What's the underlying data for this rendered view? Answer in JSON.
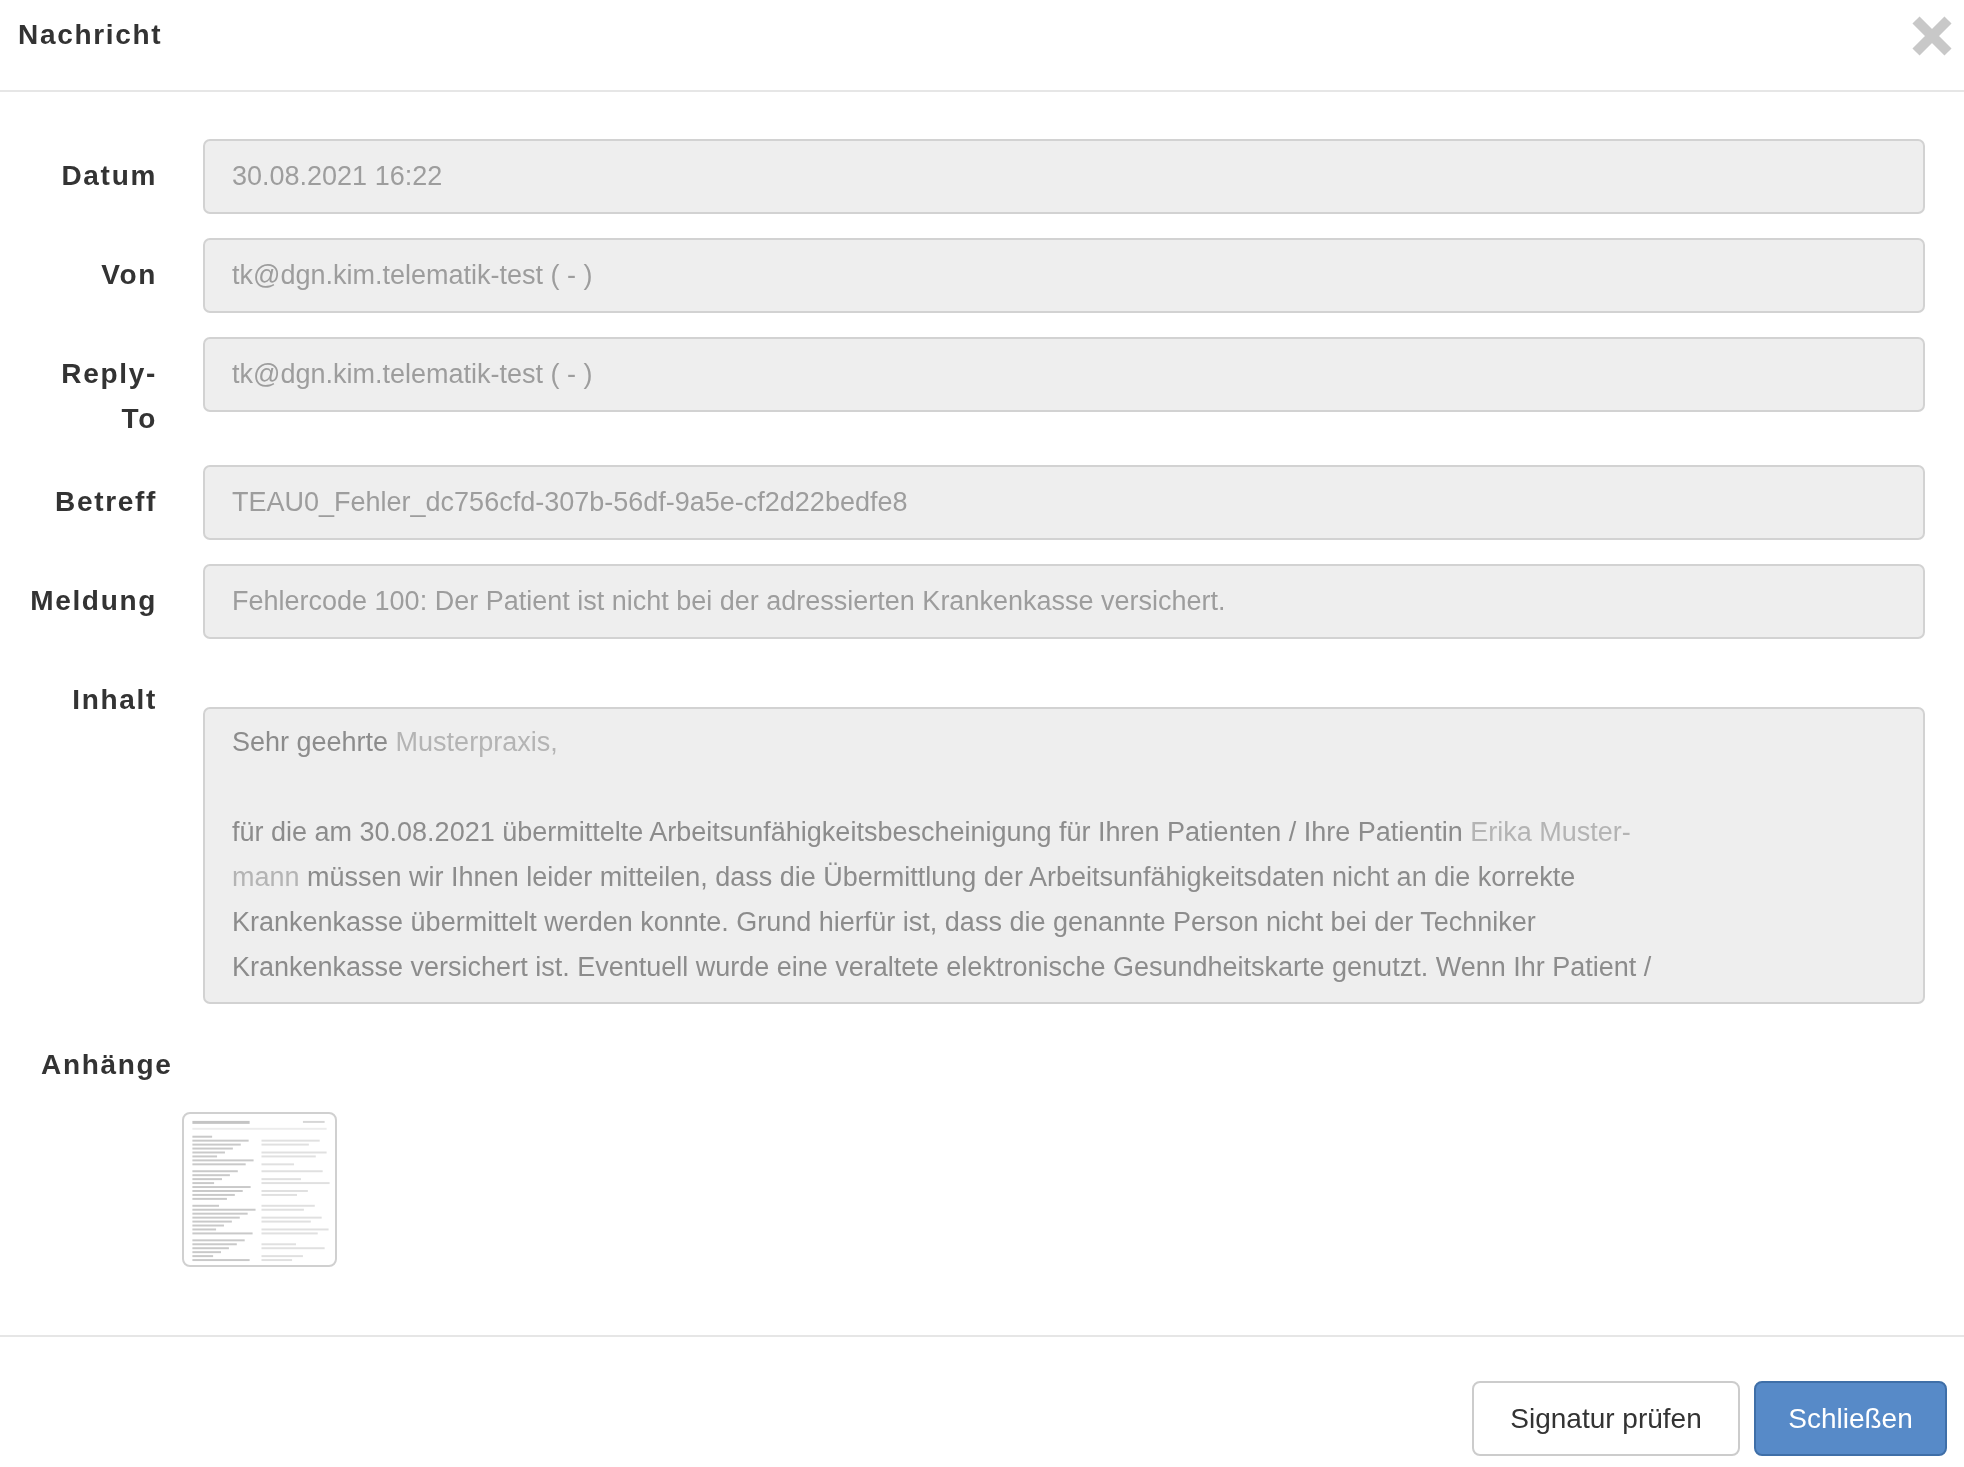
{
  "dialog": {
    "title": "Nachricht"
  },
  "fields": [
    {
      "label": "Datum",
      "value": "30.08.2021 16:22"
    },
    {
      "label": "Von",
      "value": "tk@dgn.kim.telematik-test ( - )"
    },
    {
      "label": "Reply-To",
      "value": "tk@dgn.kim.telematik-test ( - )"
    },
    {
      "label": "Betreff",
      "value": "TEAU0_Fehler_dc756cfd-307b-56df-9a5e-cf2d22bedfe8"
    },
    {
      "label": "Meldung",
      "value": "Fehlercode 100: Der Patient ist nicht bei der adressierten Krankenkasse versichert."
    }
  ],
  "content": {
    "label": "Inhalt",
    "paragraphs": [
      {
        "lines": [
          [
            {
              "kind": "text",
              "text": "Sehr geehrte "
            },
            {
              "kind": "variable",
              "text": "Musterpraxis,"
            }
          ]
        ]
      },
      {
        "lines": [
          [
            {
              "kind": "text",
              "text": "für die am 30.08.2021 übermittelte Arbeitsunfähigkeitsbescheinigung für Ihren Patienten / Ihre Patientin "
            },
            {
              "kind": "variable",
              "text": "Erika Muster-"
            }
          ],
          [
            {
              "kind": "variable",
              "text": "mann "
            },
            {
              "kind": "text",
              "text": "müssen wir Ihnen leider mitteilen, dass die Übermittlung der Arbeitsunfähigkeitsdaten nicht an die korrekte"
            }
          ],
          [
            {
              "kind": "text",
              "text": "Krankenkasse übermittelt werden konnte. Grund hierfür ist, dass die genannte Person nicht bei der Techniker"
            }
          ],
          [
            {
              "kind": "text",
              "text": "Krankenkasse versichert ist. Eventuell wurde eine veraltete elektronische Gesundheitskarte genutzt. Wenn Ihr Patient /"
            }
          ]
        ]
      }
    ]
  },
  "attachments": {
    "label": "Anhänge",
    "items": [
      {
        "kind": "document"
      }
    ]
  },
  "buttons": [
    {
      "label": "Signatur prüfen",
      "kind": "default"
    },
    {
      "label": "Schließen",
      "kind": "primary"
    }
  ]
}
